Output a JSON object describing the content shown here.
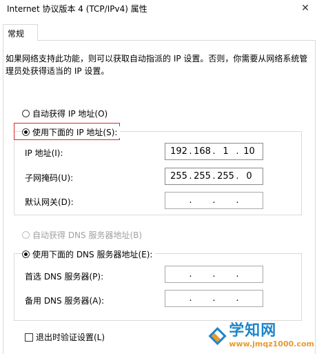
{
  "window": {
    "title": "Internet 协议版本 4 (TCP/IPv4) 属性",
    "close_glyph": "✕"
  },
  "tabs": [
    {
      "label": "常规"
    }
  ],
  "general": {
    "description": "如果网络支持此功能，则可以获取自动指派的 IP 设置。否则，你需要从网络系统管理员处获得适当的 IP 设置。",
    "auto_ip_label": "自动获得 IP 地址(O)",
    "manual_ip_label": "使用下面的 IP 地址(S):",
    "ip_fields": {
      "ip_label": "IP 地址(I):",
      "ip_value": [
        "192",
        "168",
        "1",
        "10"
      ],
      "mask_label": "子网掩码(U):",
      "mask_value": [
        "255",
        "255",
        "255",
        "0"
      ],
      "gateway_label": "默认网关(D):",
      "gateway_value": [
        "",
        "",
        "",
        ""
      ]
    },
    "auto_dns_label": "自动获得 DNS 服务器地址(B)",
    "manual_dns_label": "使用下面的 DNS 服务器地址(E):",
    "dns_fields": {
      "preferred_label": "首选 DNS 服务器(P):",
      "preferred_value": [
        "",
        "",
        "",
        ""
      ],
      "alternate_label": "备用 DNS 服务器(A):",
      "alternate_value": [
        "",
        "",
        "",
        ""
      ]
    },
    "validate_on_exit_label": "退出时验证设置(L)",
    "validate_on_exit_checked": false
  },
  "watermark": {
    "brand": "学知网",
    "site": "www.jmqz1000.com"
  },
  "colors": {
    "highlight_border": "#d9262a",
    "watermark_blue": "#1f86c9",
    "watermark_orange": "#e89a2c"
  }
}
